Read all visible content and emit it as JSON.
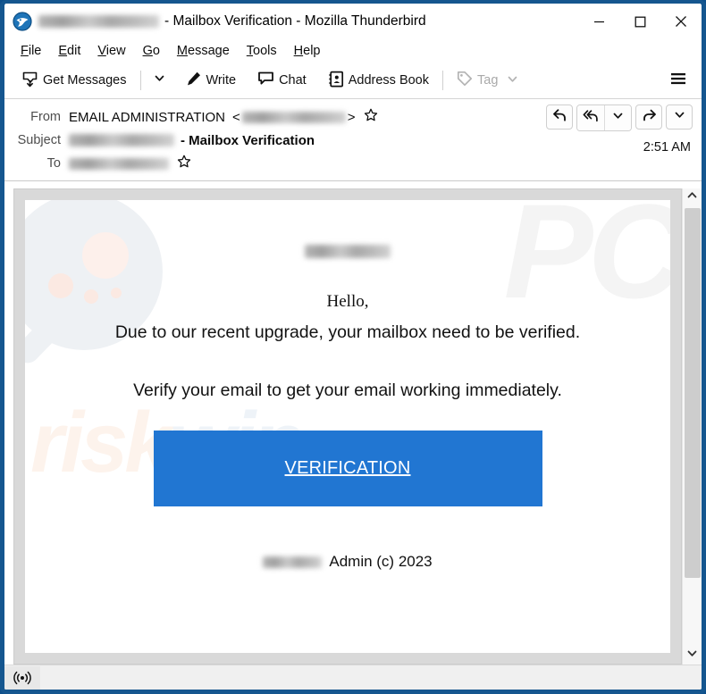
{
  "window": {
    "app_icon": "thunderbird-icon",
    "title_blurred": "redacted-email-address",
    "title_suffix": "- Mailbox Verification - Mozilla Thunderbird",
    "controls": {
      "minimize": "minimize-button",
      "maximize": "maximize-button",
      "close": "close-button"
    },
    "border_color": "#15568f"
  },
  "menubar": {
    "items": [
      {
        "accel": "F",
        "rest": "ile"
      },
      {
        "accel": "E",
        "rest": "dit"
      },
      {
        "accel": "V",
        "rest": "iew"
      },
      {
        "accel": "G",
        "rest": "o"
      },
      {
        "accel": "M",
        "rest": "essage"
      },
      {
        "accel": "T",
        "rest": "ools"
      },
      {
        "accel": "H",
        "rest": "elp"
      }
    ]
  },
  "toolbar": {
    "get_messages_label": "Get Messages",
    "get_messages_icon": "inbox-download-icon",
    "get_messages_chevron": "chevron-down-icon",
    "write_label": "Write",
    "write_icon": "pencil-icon",
    "chat_label": "Chat",
    "chat_icon": "speech-bubble-icon",
    "address_book_label": "Address Book",
    "address_book_icon": "address-book-icon",
    "tag_label": "Tag",
    "tag_icon": "tag-icon",
    "tag_chevron": "chevron-down-icon",
    "tag_disabled": true,
    "app_menu_icon": "hamburger-menu-icon"
  },
  "message_header": {
    "from_label": "From",
    "from_name": "EMAIL ADMINISTRATION",
    "from_bracket_open": "<",
    "from_address_blurred": "redacted-sender-address",
    "from_bracket_close": ">",
    "from_star_icon": "star-outline-icon",
    "subject_label": "Subject",
    "subject_blurred": "redacted-recipient-address",
    "subject_text": "- Mailbox Verification",
    "to_label": "To",
    "to_blurred": "redacted-recipient-address",
    "to_star_icon": "star-outline-icon",
    "time": "2:51 AM",
    "actions": [
      {
        "name": "reply-button",
        "icon": "reply-arrow-icon"
      },
      {
        "name": "reply-all-button",
        "icon": "reply-all-arrow-icon"
      },
      {
        "name": "reply-more-button",
        "icon": "chevron-down-icon"
      },
      {
        "name": "forward-button",
        "icon": "forward-arrow-icon"
      },
      {
        "name": "more-actions-button",
        "icon": "chevron-down-icon"
      }
    ]
  },
  "email_body": {
    "brand_blurred": "redacted-domain",
    "greeting": "Hello,",
    "line1": "Due to our recent upgrade, your mailbox need to be verified.",
    "line2": "Verify your email to get your email working immediately.",
    "cta_label": "VERIFICATION",
    "cta_color": "#2176d2",
    "footer_blurred": "redacted-domain",
    "footer_text": "Admin (c) 2023",
    "watermark_pc": "PC",
    "watermark_risk_a": "risk",
    "watermark_risk_b": "win"
  },
  "scrollbar": {
    "up_icon": "chevron-up-icon",
    "down_icon": "chevron-down-icon",
    "thumb": "scroll-thumb"
  },
  "statusbar": {
    "online_icon": "connectivity-online-icon"
  }
}
